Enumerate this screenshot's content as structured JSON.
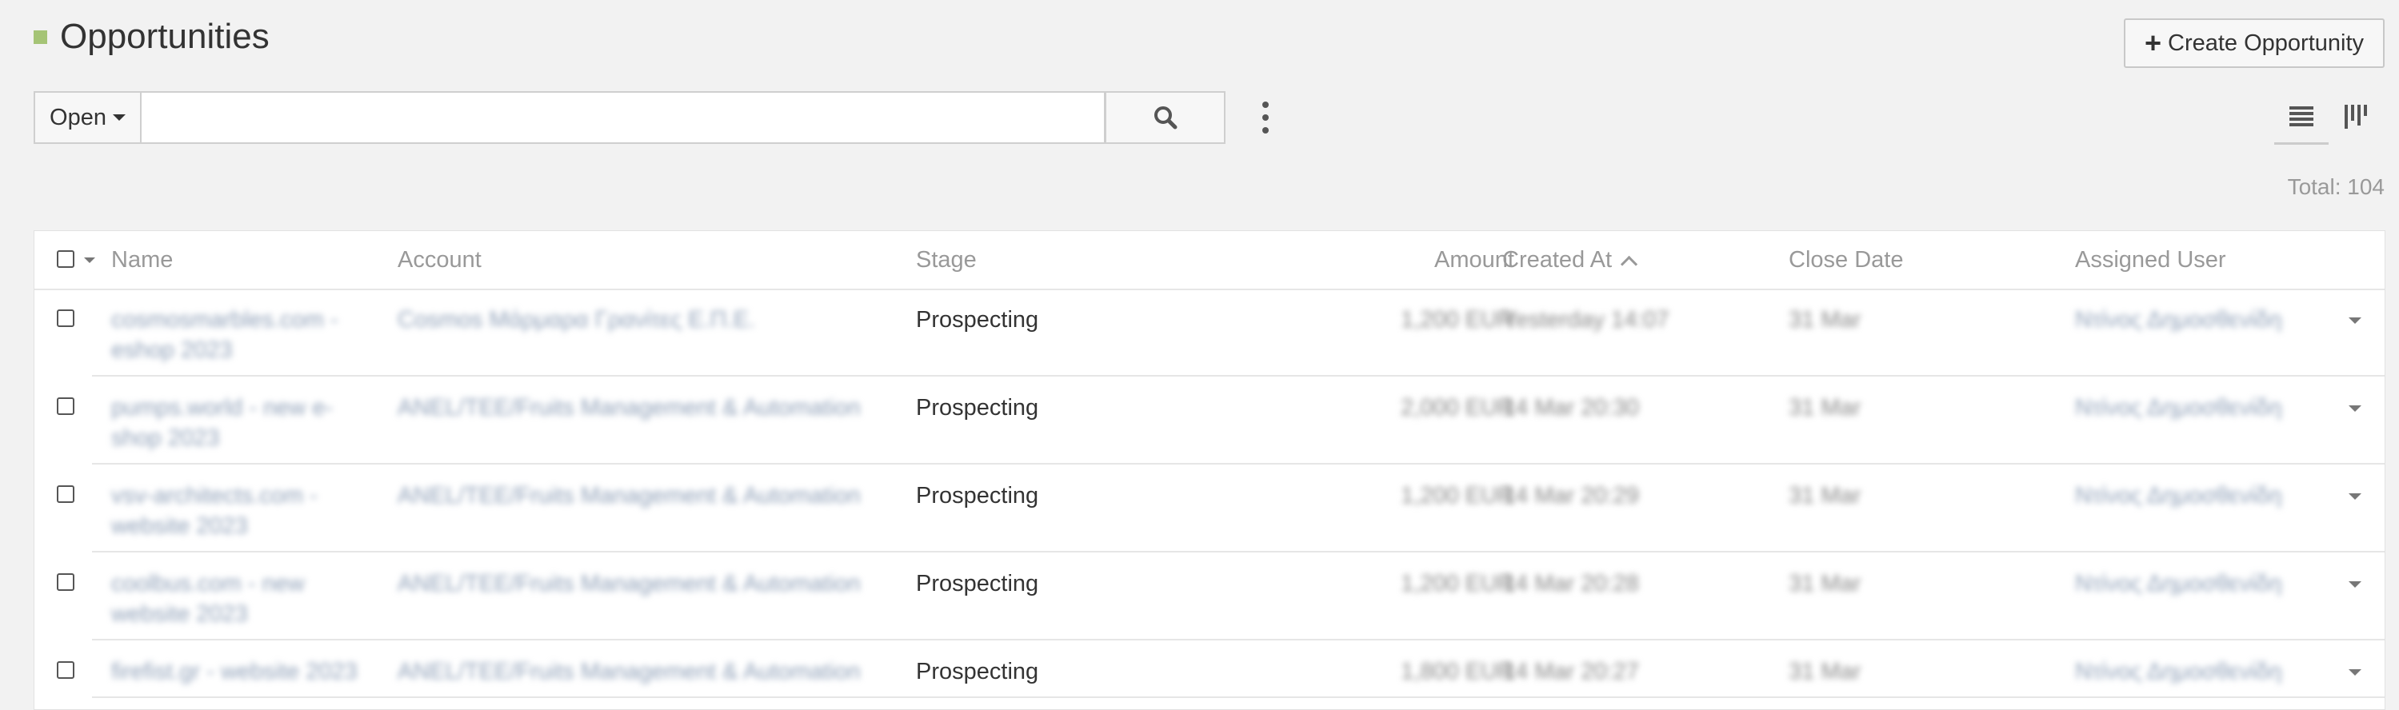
{
  "header": {
    "title": "Opportunities",
    "create_label": "Create Opportunity",
    "create_icon": "plus-icon",
    "accent_color": "#a5c476"
  },
  "toolbar": {
    "filter_label": "Open",
    "search_value": "",
    "search_placeholder": "",
    "search_icon": "search-icon",
    "more_icon": "kebab-menu-icon",
    "view_list_icon": "list-view-icon",
    "view_kanban_icon": "kanban-view-icon"
  },
  "summary": {
    "total_label": "Total: 104"
  },
  "table": {
    "columns": {
      "name": "Name",
      "account": "Account",
      "stage": "Stage",
      "amount": "Amount",
      "created_at": "Created At",
      "close_date": "Close Date",
      "assigned_user": "Assigned User"
    },
    "sort_icon": "sort-ascending-icon",
    "rows": [
      {
        "name": "cosmosmarbles.com - eshop 2023",
        "account": "Cosmos Μάρμαρα Γρανίτες Ε.Π.Ε.",
        "stage": "Prospecting",
        "amount": "1,200 EUR",
        "created_at": "Yesterday 14:07",
        "close_date": "31 Mar",
        "assigned_user": "Ντίνος Δημοσθενίδης"
      },
      {
        "name": "pumps.world - new e-shop 2023",
        "account": "ANEL/TEE/Fruits Management & Automation",
        "stage": "Prospecting",
        "amount": "2,000 EUR",
        "created_at": "14 Mar 20:30",
        "close_date": "31 Mar",
        "assigned_user": "Ντίνος Δημοσθενίδης"
      },
      {
        "name": "vsv-architects.com - website 2023",
        "account": "ANEL/TEE/Fruits Management & Automation",
        "stage": "Prospecting",
        "amount": "1,200 EUR",
        "created_at": "14 Mar 20:29",
        "close_date": "31 Mar",
        "assigned_user": "Ντίνος Δημοσθενίδης"
      },
      {
        "name": "coolbus.com - new website 2023",
        "account": "ANEL/TEE/Fruits Management & Automation",
        "stage": "Prospecting",
        "amount": "1,200 EUR",
        "created_at": "14 Mar 20:28",
        "close_date": "31 Mar",
        "assigned_user": "Ντίνος Δημοσθενίδης"
      },
      {
        "name": "firefist.gr - website 2023",
        "account": "ANEL/TEE/Fruits Management & Automation",
        "stage": "Prospecting",
        "amount": "1,800 EUR",
        "created_at": "14 Mar 20:27",
        "close_date": "31 Mar",
        "assigned_user": "Ντίνος Δημοσθενίδης"
      }
    ]
  }
}
